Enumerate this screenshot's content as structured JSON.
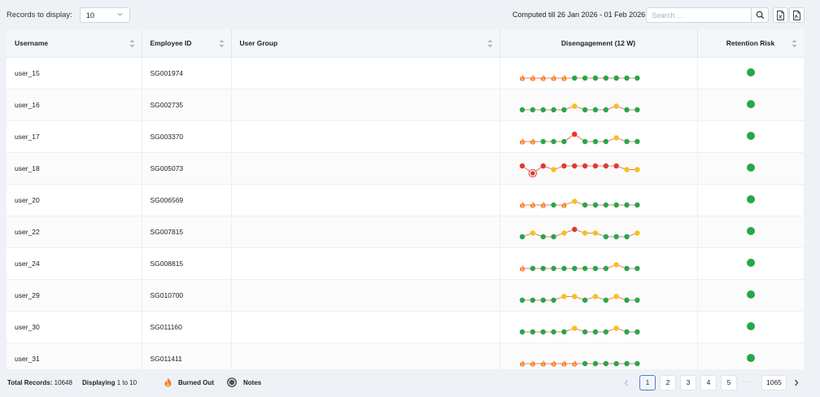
{
  "toolbar": {
    "records_label": "Records to display:",
    "records_value": "10",
    "computed_text": "Computed till 26 Jan 2026 - 01 Feb 2026",
    "search_placeholder": "Search ..."
  },
  "table": {
    "columns": [
      "Username",
      "Employee ID",
      "User Group",
      "Disengagement (12 W)",
      "Retention Risk"
    ],
    "rows": [
      {
        "username": "user_15",
        "employee_id": "SG001974",
        "user_group": "",
        "spark": [
          "b",
          "b",
          "b",
          "b",
          "b",
          "g",
          "g",
          "g",
          "g",
          "g",
          "g",
          "g"
        ],
        "risk": "green"
      },
      {
        "username": "user_16",
        "employee_id": "SG002735",
        "user_group": "",
        "spark": [
          "g",
          "g",
          "g",
          "g",
          "g",
          "y",
          "g",
          "g",
          "g",
          "y",
          "g",
          "g"
        ],
        "risk": "green"
      },
      {
        "username": "user_17",
        "employee_id": "SG003370",
        "user_group": "",
        "spark": [
          "b",
          "b",
          "g",
          "g",
          "g",
          "r",
          "g",
          "g",
          "g",
          "y",
          "g",
          "g"
        ],
        "risk": "green"
      },
      {
        "username": "user_18",
        "employee_id": "SG005073",
        "user_group": "",
        "spark": [
          "r",
          "n",
          "r",
          "y",
          "r",
          "r",
          "r",
          "r",
          "r",
          "r",
          "y",
          "y"
        ],
        "risk": "green"
      },
      {
        "username": "user_20",
        "employee_id": "SG006569",
        "user_group": "",
        "spark": [
          "b",
          "b",
          "b",
          "g",
          "b",
          "y",
          "g",
          "g",
          "g",
          "g",
          "g",
          "g"
        ],
        "risk": "green"
      },
      {
        "username": "user_22",
        "employee_id": "SG007815",
        "user_group": "",
        "spark": [
          "g",
          "y",
          "g",
          "g",
          "y",
          "r",
          "y",
          "y",
          "g",
          "g",
          "g",
          "y"
        ],
        "risk": "green"
      },
      {
        "username": "user_24",
        "employee_id": "SG008815",
        "user_group": "",
        "spark": [
          "b",
          "g",
          "g",
          "g",
          "g",
          "g",
          "g",
          "g",
          "g",
          "y",
          "g",
          "g"
        ],
        "risk": "green"
      },
      {
        "username": "user_29",
        "employee_id": "SG010700",
        "user_group": "",
        "spark": [
          "g",
          "g",
          "g",
          "g",
          "y",
          "y",
          "g",
          "y",
          "g",
          "y",
          "g",
          "g"
        ],
        "risk": "green"
      },
      {
        "username": "user_30",
        "employee_id": "SG011160",
        "user_group": "",
        "spark": [
          "g",
          "g",
          "g",
          "g",
          "g",
          "y",
          "g",
          "g",
          "g",
          "y",
          "g",
          "g"
        ],
        "risk": "green"
      },
      {
        "username": "user_31",
        "employee_id": "SG011411",
        "user_group": "",
        "spark": [
          "b",
          "b",
          "b",
          "b",
          "b",
          "b",
          "g",
          "g",
          "g",
          "g",
          "g",
          "g"
        ],
        "risk": "green"
      }
    ]
  },
  "footer": {
    "total_label": "Total Records:",
    "total_value": "10648",
    "displaying_label": "Displaying",
    "displaying_range": "1 to 10",
    "legend_burned_out": "Burned Out",
    "legend_notes": "Notes"
  },
  "pagination": {
    "pages": [
      "1",
      "2",
      "3",
      "4",
      "5"
    ],
    "active": "1",
    "ellipsis": "···",
    "last": "1065"
  },
  "colors": {
    "green": "#27a74a",
    "yellow": "#f5c21b",
    "red": "#e03b2f",
    "burned_out": "#f47a3a",
    "accent": "#4a80c8"
  },
  "icons": {
    "search": "search-icon",
    "export_excel": "excel-export-icon",
    "export_pdf": "pdf-export-icon",
    "sort": "sort-icon",
    "burned_out": "flame-icon",
    "notes": "notes-ring-icon"
  }
}
